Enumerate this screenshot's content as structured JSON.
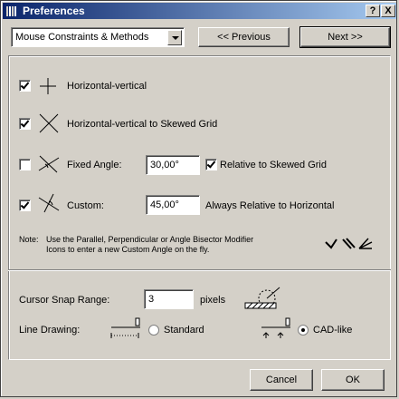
{
  "window": {
    "title": "Preferences"
  },
  "titlebar_buttons": {
    "help": "?",
    "close": "X"
  },
  "header": {
    "category": "Mouse Constraints & Methods",
    "prev_label": "<< Previous",
    "next_label": "Next >>"
  },
  "constraints": {
    "horizontal_vertical": {
      "label": "Horizontal-vertical",
      "checked": true
    },
    "skewed_grid": {
      "label": "Horizontal-vertical to Skewed Grid",
      "checked": true
    },
    "fixed_angle": {
      "label": "Fixed Angle:",
      "checked": false,
      "value": "30,00°",
      "relative_label": "Relative to Skewed Grid",
      "relative_checked": true
    },
    "custom": {
      "label": "Custom:",
      "checked": true,
      "value": "45,00°",
      "always_label": "Always Relative to Horizontal"
    }
  },
  "note": {
    "label": "Note:",
    "line1": "Use the Parallel, Perpendicular or Angle Bisector Modifier",
    "line2": "Icons to enter a new Custom Angle on the fly."
  },
  "cursor_snap": {
    "label": "Cursor Snap Range:",
    "value": "3",
    "unit": "pixels"
  },
  "line_drawing": {
    "label": "Line Drawing:",
    "option_standard": "Standard",
    "option_cad": "CAD-like",
    "selected": "CAD-like"
  },
  "footer": {
    "cancel_label": "Cancel",
    "ok_label": "OK"
  }
}
